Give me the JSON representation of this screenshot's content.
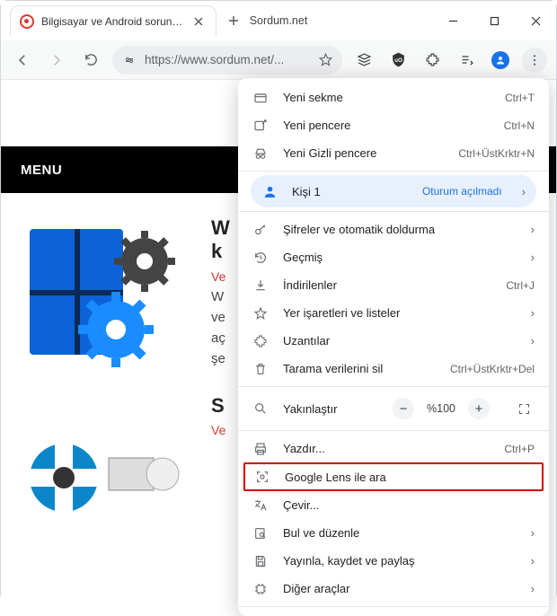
{
  "window_title": "Sordum.net",
  "tab": {
    "title": "Bilgisayar ve Android sorunların"
  },
  "address": {
    "url_display": "https://www.sordum.net/..."
  },
  "page": {
    "menu_label": "MENU",
    "card1": {
      "title_line1": "W",
      "title_line2": "k",
      "date_prefix": "Ve",
      "p1": "W",
      "p2": "ve",
      "p3": "aç",
      "p4": "şe"
    },
    "card2": {
      "title": "S",
      "date_prefix": "Ve"
    }
  },
  "menu": {
    "new_tab": {
      "label": "Yeni sekme",
      "hint": "Ctrl+T"
    },
    "new_window": {
      "label": "Yeni pencere",
      "hint": "Ctrl+N"
    },
    "incognito": {
      "label": "Yeni Gizli pencere",
      "hint": "Ctrl+ÜstKrktr+N"
    },
    "profile": {
      "label": "Kişi 1",
      "hint": "Oturum açılmadı"
    },
    "passwords": {
      "label": "Şifreler ve otomatik doldurma"
    },
    "history": {
      "label": "Geçmiş"
    },
    "downloads": {
      "label": "İndirilenler",
      "hint": "Ctrl+J"
    },
    "bookmarks": {
      "label": "Yer işaretleri ve listeler"
    },
    "extensions": {
      "label": "Uzantılar"
    },
    "clear_data": {
      "label": "Tarama verilerini sil",
      "hint": "Ctrl+ÜstKrktr+Del"
    },
    "zoom": {
      "label": "Yakınlaştır",
      "value": "%100"
    },
    "print": {
      "label": "Yazdır...",
      "hint": "Ctrl+P"
    },
    "lens": {
      "label": "Google Lens ile ara"
    },
    "translate": {
      "label": "Çevir..."
    },
    "find": {
      "label": "Bul ve düzenle"
    },
    "cast": {
      "label": "Yayınla, kaydet ve paylaş"
    },
    "more": {
      "label": "Diğer araçlar"
    }
  }
}
